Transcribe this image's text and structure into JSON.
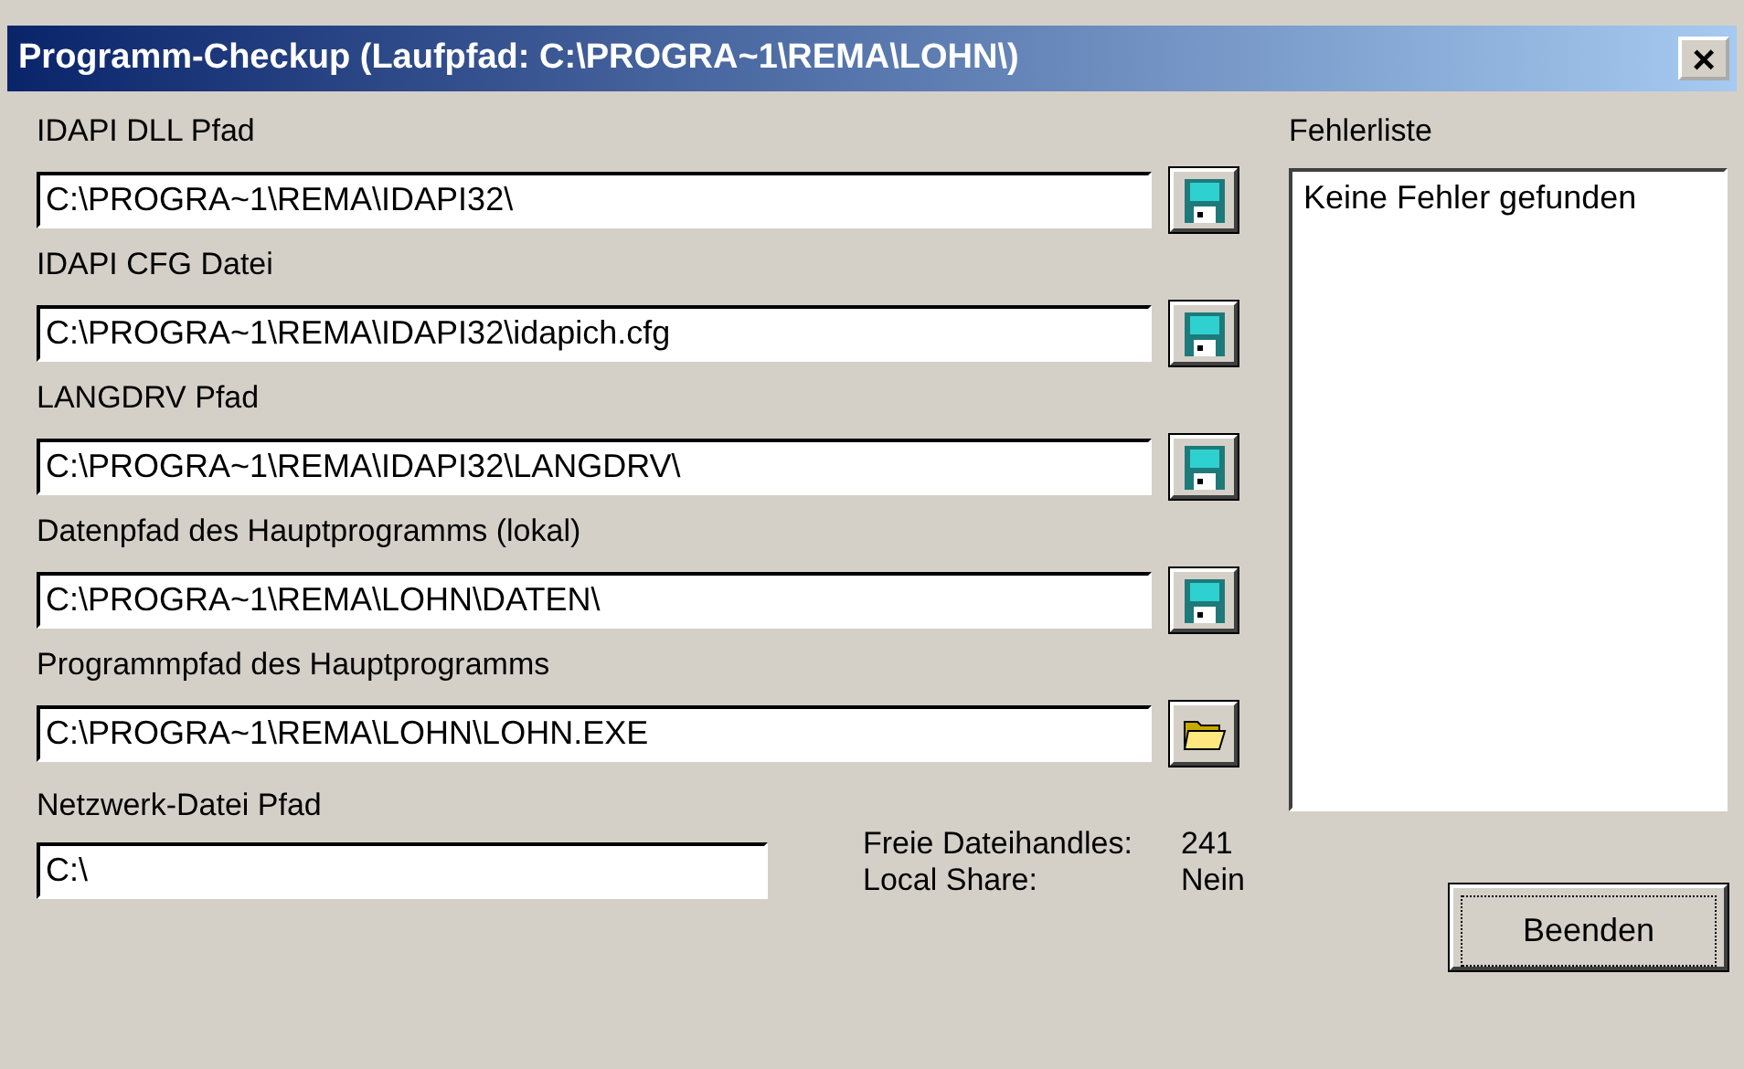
{
  "window": {
    "title": "Programm-Checkup (Laufpfad: C:\\PROGRA~1\\REMA\\LOHN\\)",
    "close": "×"
  },
  "paths": [
    {
      "label": "IDAPI DLL Pfad",
      "value": "C:\\PROGRA~1\\REMA\\IDAPI32\\",
      "kind": "save"
    },
    {
      "label": "IDAPI CFG Datei",
      "value": "C:\\PROGRA~1\\REMA\\IDAPI32\\idapich.cfg",
      "kind": "save"
    },
    {
      "label": "LANGDRV Pfad",
      "value": "C:\\PROGRA~1\\REMA\\IDAPI32\\LANGDRV\\",
      "kind": "save"
    },
    {
      "label": "Datenpfad des Hauptprogramms (lokal)",
      "value": "C:\\PROGRA~1\\REMA\\LOHN\\DATEN\\",
      "kind": "save"
    },
    {
      "label": "Programmpfad des Hauptprogramms",
      "value": "C:\\PROGRA~1\\REMA\\LOHN\\LOHN.EXE",
      "kind": "folder"
    }
  ],
  "network": {
    "label": "Netzwerk-Datei Pfad",
    "value": "C:\\"
  },
  "info": [
    {
      "label": "Freie Dateihandles:",
      "value": "241"
    },
    {
      "label": "Local Share:",
      "value": "Nein"
    }
  ],
  "errors": {
    "label": "Fehlerliste",
    "items": [
      "Keine Fehler gefunden"
    ]
  },
  "buttons": [
    "Beenden"
  ]
}
